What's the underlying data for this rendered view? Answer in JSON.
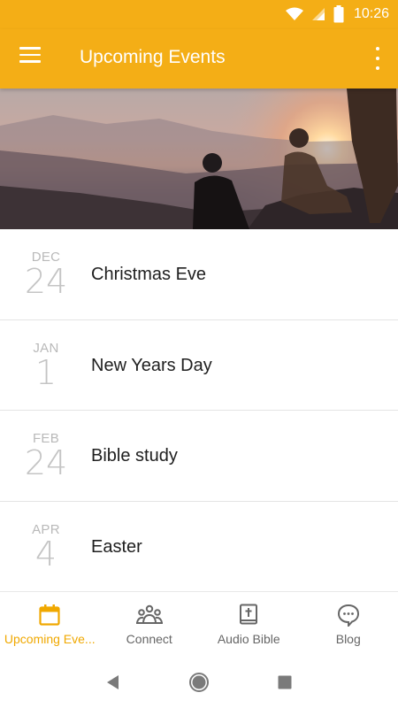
{
  "status_bar": {
    "time": "10:26"
  },
  "app_bar": {
    "title": "Upcoming Events"
  },
  "events": [
    {
      "month": "DEC",
      "day": "24",
      "title": "Christmas Eve"
    },
    {
      "month": "JAN",
      "day": "1",
      "title": "New Years Day"
    },
    {
      "month": "FEB",
      "day": "24",
      "title": "Bible study"
    },
    {
      "month": "APR",
      "day": "4",
      "title": "Easter"
    }
  ],
  "bottom_nav": [
    {
      "label": "Upcoming Eve...",
      "icon": "calendar-icon",
      "active": true
    },
    {
      "label": "Connect",
      "icon": "people-group-icon",
      "active": false
    },
    {
      "label": "Audio Bible",
      "icon": "bible-icon",
      "active": false
    },
    {
      "label": "Blog",
      "icon": "chat-bubble-icon",
      "active": false
    }
  ],
  "colors": {
    "primary": "#f4ae16",
    "active_nav": "#f0a800",
    "date_text": "#b9b9b9"
  }
}
